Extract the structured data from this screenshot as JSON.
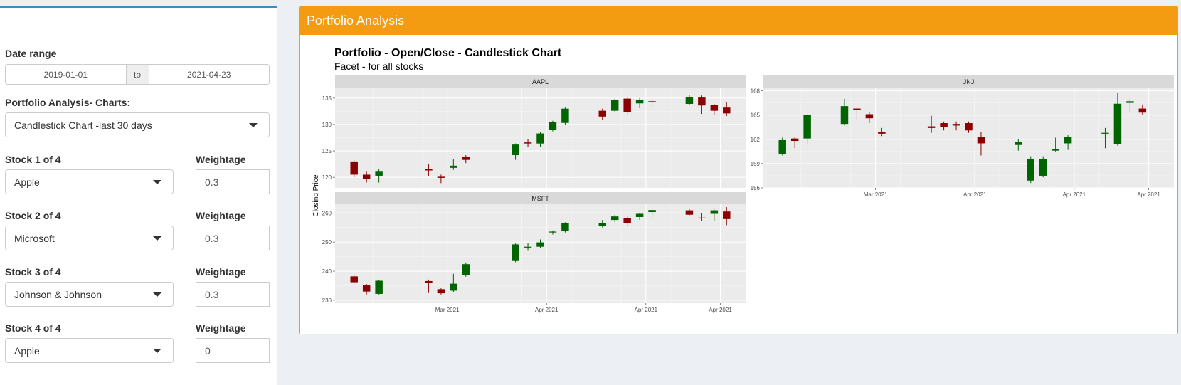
{
  "sidebar": {
    "date_range": {
      "label": "Date range",
      "start": "2019-01-01",
      "separator": "to",
      "end": "2021-04-23"
    },
    "charts_select": {
      "label": "Portfolio Analysis- Charts:",
      "value": "Candlestick Chart -last 30 days"
    },
    "weight_label": "Weightage",
    "stocks": [
      {
        "label": "Stock 1 of 4",
        "value": "Apple",
        "weight": "0.3"
      },
      {
        "label": "Stock 2 of 4",
        "value": "Microsoft",
        "weight": "0.3"
      },
      {
        "label": "Stock 3 of 4",
        "value": "Johnson & Johnson",
        "weight": "0.3"
      },
      {
        "label": "Stock 4 of 4",
        "value": "Apple",
        "weight": "0"
      }
    ]
  },
  "main": {
    "box_title": "Portfolio Analysis"
  },
  "colors": {
    "up": "#006400",
    "down": "#8b0000",
    "header": "#f39c12",
    "sidebar_accent": "#3c8dbc",
    "panel": "#ebebeb",
    "strip": "#d9d9d9"
  },
  "chart_data": {
    "type": "candlestick",
    "title": "Portfolio - Open/Close - Candlestick Chart",
    "subtitle": "Facet - for all stocks",
    "ylabel": "Closing Price",
    "x_tick_labels": [
      "Mar 2021",
      "Apr 2021",
      "Apr 2021",
      "Apr 2021"
    ],
    "facets": [
      {
        "name": "AAPL",
        "yticks": [
          120,
          125,
          130,
          135
        ],
        "ylim": [
          118,
          137
        ],
        "candles": [
          {
            "i": 0,
            "open": 123,
            "close": 120.5,
            "low": 120,
            "high": 123.2
          },
          {
            "i": 1,
            "open": 120.5,
            "close": 119.7,
            "low": 119,
            "high": 121.2
          },
          {
            "i": 2,
            "open": 120.3,
            "close": 121.2,
            "low": 119,
            "high": 121.5
          },
          {
            "i": 6,
            "open": 121.6,
            "close": 121.3,
            "low": 120.3,
            "high": 122.5
          },
          {
            "i": 7,
            "open": 120.1,
            "close": 119.9,
            "low": 118.9,
            "high": 120.5
          },
          {
            "i": 8,
            "open": 121.8,
            "close": 122.2,
            "low": 121.4,
            "high": 123.4
          },
          {
            "i": 9,
            "open": 123.8,
            "close": 123.3,
            "low": 122.7,
            "high": 124.2
          },
          {
            "i": 13,
            "open": 124.2,
            "close": 126.2,
            "low": 123.3,
            "high": 126.4
          },
          {
            "i": 14,
            "open": 126.6,
            "close": 126.4,
            "low": 125.8,
            "high": 127.2
          },
          {
            "i": 15,
            "open": 126.4,
            "close": 128.3,
            "low": 125.7,
            "high": 128.6
          },
          {
            "i": 16,
            "open": 129,
            "close": 130.4,
            "low": 128.7,
            "high": 130.7
          },
          {
            "i": 17,
            "open": 130.3,
            "close": 133,
            "low": 130,
            "high": 133.2
          },
          {
            "i": 20,
            "open": 132.6,
            "close": 131.5,
            "low": 130.8,
            "high": 133
          },
          {
            "i": 21,
            "open": 132.6,
            "close": 134.6,
            "low": 132.3,
            "high": 134.9
          },
          {
            "i": 22,
            "open": 134.9,
            "close": 132.4,
            "low": 132,
            "high": 135.1
          },
          {
            "i": 23,
            "open": 134,
            "close": 134.6,
            "low": 133.1,
            "high": 135
          },
          {
            "i": 24,
            "open": 134.4,
            "close": 134.2,
            "low": 133.5,
            "high": 134.9
          },
          {
            "i": 27,
            "open": 133.9,
            "close": 135.2,
            "low": 133.7,
            "high": 135.6
          },
          {
            "i": 28,
            "open": 135.1,
            "close": 133.6,
            "low": 132,
            "high": 135.5
          },
          {
            "i": 29,
            "open": 133.7,
            "close": 132.6,
            "low": 131.8,
            "high": 133.9
          },
          {
            "i": 30,
            "open": 133.2,
            "close": 132.1,
            "low": 131.6,
            "high": 134.2
          }
        ]
      },
      {
        "name": "JNJ",
        "yticks": [
          156,
          159,
          162,
          165,
          168
        ],
        "ylim": [
          156,
          168.4
        ],
        "candles": [
          {
            "i": 0,
            "open": 160.2,
            "close": 161.9,
            "low": 160,
            "high": 162.2
          },
          {
            "i": 1,
            "open": 162.1,
            "close": 161.8,
            "low": 160.9,
            "high": 162.3
          },
          {
            "i": 2,
            "open": 162.1,
            "close": 165,
            "low": 161.4,
            "high": 165.1
          },
          {
            "i": 5,
            "open": 163.9,
            "close": 166.1,
            "low": 163.7,
            "high": 167
          },
          {
            "i": 6,
            "open": 165.8,
            "close": 165.6,
            "low": 164.4,
            "high": 166
          },
          {
            "i": 7,
            "open": 165.1,
            "close": 164.6,
            "low": 164,
            "high": 165.4
          },
          {
            "i": 8,
            "open": 162.9,
            "close": 162.7,
            "low": 162.4,
            "high": 163.4
          },
          {
            "i": 12,
            "open": 163.6,
            "close": 163.4,
            "low": 162.8,
            "high": 164.9
          },
          {
            "i": 13,
            "open": 164,
            "close": 163.5,
            "low": 163.1,
            "high": 164.2
          },
          {
            "i": 14,
            "open": 163.9,
            "close": 163.7,
            "low": 163.1,
            "high": 164.2
          },
          {
            "i": 15,
            "open": 164,
            "close": 163.1,
            "low": 162.8,
            "high": 164.2
          },
          {
            "i": 16,
            "open": 162.3,
            "close": 161.5,
            "low": 160,
            "high": 162.9
          },
          {
            "i": 19,
            "open": 161.3,
            "close": 161.7,
            "low": 160.6,
            "high": 162
          },
          {
            "i": 20,
            "open": 156.9,
            "close": 159.6,
            "low": 156.6,
            "high": 159.9
          },
          {
            "i": 21,
            "open": 157.5,
            "close": 159.6,
            "low": 157.3,
            "high": 159.9
          },
          {
            "i": 22,
            "open": 160.6,
            "close": 160.8,
            "low": 160.5,
            "high": 162.2
          },
          {
            "i": 23,
            "open": 161.5,
            "close": 162.3,
            "low": 160.7,
            "high": 162.5
          },
          {
            "i": 26,
            "open": 162.7,
            "close": 162.8,
            "low": 160.9,
            "high": 163.4
          },
          {
            "i": 27,
            "open": 161.4,
            "close": 166.4,
            "low": 161.2,
            "high": 167.8
          },
          {
            "i": 28,
            "open": 166.5,
            "close": 166.7,
            "low": 165.3,
            "high": 167
          },
          {
            "i": 29,
            "open": 165.8,
            "close": 165.3,
            "low": 165,
            "high": 166.3
          }
        ]
      },
      {
        "name": "MSFT",
        "yticks": [
          230,
          240,
          250,
          260
        ],
        "ylim": [
          229,
          263
        ],
        "candles": [
          {
            "i": 0,
            "open": 238.2,
            "close": 236.2,
            "low": 235.8,
            "high": 238.5
          },
          {
            "i": 1,
            "open": 235.1,
            "close": 233,
            "low": 232,
            "high": 235.6
          },
          {
            "i": 2,
            "open": 232.2,
            "close": 236.7,
            "low": 232,
            "high": 237
          },
          {
            "i": 6,
            "open": 236.6,
            "close": 235.9,
            "low": 232.5,
            "high": 237.1
          },
          {
            "i": 7,
            "open": 233.8,
            "close": 232.4,
            "low": 232,
            "high": 234.1
          },
          {
            "i": 8,
            "open": 233.3,
            "close": 235.7,
            "low": 232.9,
            "high": 239.1
          },
          {
            "i": 9,
            "open": 238.6,
            "close": 242.4,
            "low": 238.1,
            "high": 243
          },
          {
            "i": 13,
            "open": 243.5,
            "close": 249.2,
            "low": 243.1,
            "high": 249.5
          },
          {
            "i": 14,
            "open": 248.2,
            "close": 248.4,
            "low": 247,
            "high": 249.6
          },
          {
            "i": 15,
            "open": 248.4,
            "close": 249.9,
            "low": 247.9,
            "high": 250.9
          },
          {
            "i": 16,
            "open": 253.3,
            "close": 253.6,
            "low": 252.6,
            "high": 254
          },
          {
            "i": 17,
            "open": 253.7,
            "close": 256.5,
            "low": 253.3,
            "high": 256.8
          },
          {
            "i": 20,
            "open": 255.6,
            "close": 256.4,
            "low": 255,
            "high": 257.6
          },
          {
            "i": 21,
            "open": 257.6,
            "close": 258.8,
            "low": 256.8,
            "high": 259.4
          },
          {
            "i": 22,
            "open": 258.2,
            "close": 256.6,
            "low": 255.5,
            "high": 259.1
          },
          {
            "i": 23,
            "open": 258.6,
            "close": 259.7,
            "low": 257.6,
            "high": 260.1
          },
          {
            "i": 24,
            "open": 260.3,
            "close": 261,
            "low": 258.2,
            "high": 261.1
          },
          {
            "i": 27,
            "open": 260.9,
            "close": 259.4,
            "low": 259.2,
            "high": 261.4
          },
          {
            "i": 28,
            "open": 258.4,
            "close": 258.2,
            "low": 257.2,
            "high": 260
          },
          {
            "i": 29,
            "open": 259.7,
            "close": 260.9,
            "low": 257.4,
            "high": 261.2
          },
          {
            "i": 30,
            "open": 260.5,
            "close": 257.9,
            "low": 255.8,
            "high": 262
          }
        ]
      }
    ]
  }
}
